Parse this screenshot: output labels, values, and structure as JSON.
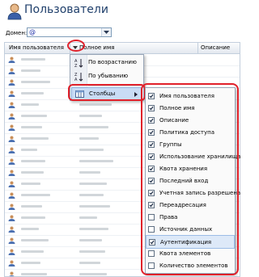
{
  "page": {
    "title": "Пользователи"
  },
  "domain": {
    "label": "Домен:",
    "value": "@"
  },
  "grid": {
    "columns": [
      "Имя пользователя",
      "Полное имя",
      "Описание"
    ]
  },
  "sort_menu": {
    "items": [
      {
        "label": "По возрастанию",
        "icon": "sort-ascending-icon"
      },
      {
        "label": "По убыванию",
        "icon": "sort-descending-icon"
      },
      {
        "label": "Столбцы",
        "icon": "columns-icon",
        "has_submenu": true,
        "selected": true
      }
    ]
  },
  "columns_menu": {
    "items": [
      {
        "label": "Имя пользователя",
        "checked": true
      },
      {
        "label": "Полное имя",
        "checked": true
      },
      {
        "label": "Описание",
        "checked": true
      },
      {
        "label": "Политика доступа",
        "checked": true
      },
      {
        "label": "Группы",
        "checked": true
      },
      {
        "label": "Использование хранилища",
        "checked": true
      },
      {
        "label": "Квота хранения",
        "checked": true
      },
      {
        "label": "Последний вход",
        "checked": true
      },
      {
        "label": "Учетная запись разрешена",
        "checked": true
      },
      {
        "label": "Переадресация",
        "checked": true
      },
      {
        "label": "Права",
        "checked": false
      },
      {
        "label": "Источник данных",
        "checked": false
      },
      {
        "label": "Аутентификация",
        "checked": true,
        "highlighted": true
      },
      {
        "label": "Квота элементов",
        "checked": false
      },
      {
        "label": "Количество элементов",
        "checked": false
      }
    ]
  },
  "colors": {
    "accent_red": "#e0202a",
    "title_blue": "#1f3f6b",
    "highlight_blue": "#c9dcf5"
  }
}
